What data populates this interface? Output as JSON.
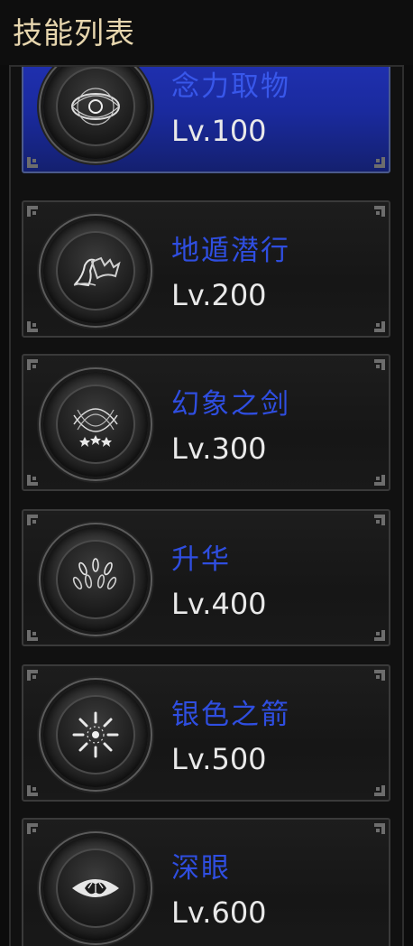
{
  "header": {
    "title": "技能列表"
  },
  "skills": [
    {
      "name": "念力取物",
      "level": "Lv.100",
      "icon": "eye-icon",
      "selected": true
    },
    {
      "name": "地遁潜行",
      "level": "Lv.200",
      "icon": "bat-wing-icon",
      "selected": false
    },
    {
      "name": "幻象之剑",
      "level": "Lv.300",
      "icon": "woven-stars-icon",
      "selected": false
    },
    {
      "name": "升华",
      "level": "Lv.400",
      "icon": "rising-petals-icon",
      "selected": false
    },
    {
      "name": "银色之箭",
      "level": "Lv.500",
      "icon": "starburst-icon",
      "selected": false
    },
    {
      "name": "深眼",
      "level": "Lv.600",
      "icon": "deep-eye-icon",
      "selected": false
    }
  ],
  "colors": {
    "skill_name": "#2f4ee0",
    "level_text": "#e9e9e9",
    "header_text": "#e7d6ae",
    "selected_bg": "#1a2a9e"
  }
}
